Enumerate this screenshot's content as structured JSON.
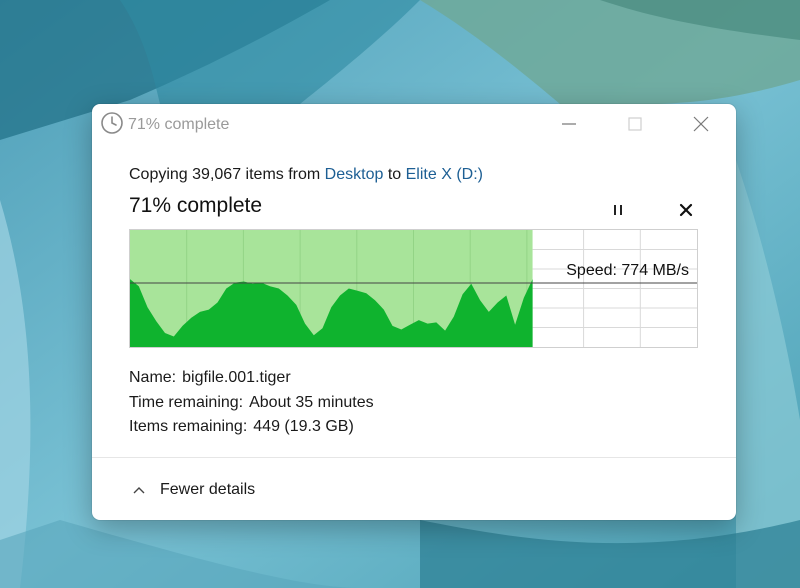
{
  "window": {
    "title": "71% complete"
  },
  "header": {
    "prefix": "Copying",
    "item_count": "39,067",
    "items_word": "items from",
    "source": "Desktop",
    "to_word": "to",
    "destination": "Elite X (D:)",
    "percent_text": "71% complete"
  },
  "controls": {
    "pause_glyph": "II",
    "cancel_glyph": "✕"
  },
  "graph": {
    "speed_label": "Speed: 774 MB/s",
    "progress": 0.71,
    "colors": {
      "progress_fill": "#a8e49a",
      "speed_fill": "#0fb32e",
      "grid_line": "#d9d9d9",
      "speed_line": "#444444"
    },
    "speed_samples": [
      0.58,
      0.52,
      0.34,
      0.22,
      0.12,
      0.09,
      0.18,
      0.25,
      0.3,
      0.32,
      0.38,
      0.5,
      0.55,
      0.56,
      0.54,
      0.55,
      0.52,
      0.5,
      0.44,
      0.36,
      0.2,
      0.1,
      0.16,
      0.34,
      0.44,
      0.5,
      0.48,
      0.46,
      0.4,
      0.32,
      0.18,
      0.15,
      0.19,
      0.23,
      0.2,
      0.21,
      0.14,
      0.26,
      0.45,
      0.54,
      0.4,
      0.3,
      0.38,
      0.44,
      0.19,
      0.42,
      0.58
    ]
  },
  "details": {
    "name_label": "Name:",
    "name_value": "bigfile.001.tiger",
    "time_label": "Time remaining:",
    "time_value": "About 35 minutes",
    "items_label": "Items remaining:",
    "items_value": "449 (19.3 GB)"
  },
  "footer": {
    "toggle_label": "Fewer details"
  }
}
